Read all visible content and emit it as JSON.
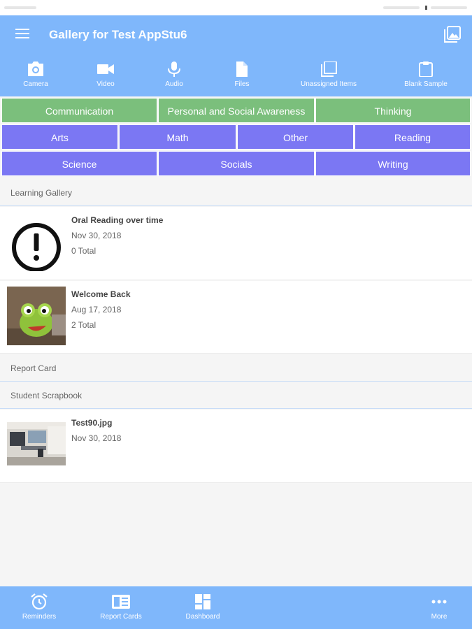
{
  "header": {
    "title": "Gallery for Test AppStu6"
  },
  "toolbar": {
    "items": [
      {
        "label": "Camera",
        "icon": "camera-icon"
      },
      {
        "label": "Video",
        "icon": "video-icon"
      },
      {
        "label": "Audio",
        "icon": "microphone-icon"
      },
      {
        "label": "Files",
        "icon": "file-icon"
      },
      {
        "label": "Unassigned Items",
        "icon": "stack-icon"
      },
      {
        "label": "Blank Sample",
        "icon": "clipboard-icon"
      }
    ]
  },
  "categories": {
    "row1": [
      "Communication",
      "Personal and Social Awareness",
      "Thinking"
    ],
    "row2": [
      "Arts",
      "Math",
      "Other",
      "Reading"
    ],
    "row3": [
      "Science",
      "Socials",
      "Writing"
    ]
  },
  "sections": {
    "learning_gallery": "Learning Gallery",
    "report_card": "Report Card",
    "student_scrapbook": "Student Scrapbook"
  },
  "items": [
    {
      "title": "Oral Reading over time",
      "date": "Nov 30, 2018",
      "count": "0 Total",
      "icon": "alert-icon"
    },
    {
      "title": "Welcome Back",
      "date": "Aug 17, 2018",
      "count": "2 Total"
    },
    {
      "title": "Test90.jpg",
      "date": "Nov 30, 2018"
    }
  ],
  "bottom_nav": [
    {
      "label": "Reminders",
      "icon": "alarm-clock-icon"
    },
    {
      "label": "Report Cards",
      "icon": "report-card-icon"
    },
    {
      "label": "Dashboard",
      "icon": "dashboard-icon"
    },
    {
      "label": "More",
      "icon": "more-dots-icon"
    }
  ],
  "colors": {
    "primary": "#7fb7fb",
    "category_green": "#7bbf7c",
    "category_purple": "#7b77f3",
    "background": "#f5f5f5"
  }
}
